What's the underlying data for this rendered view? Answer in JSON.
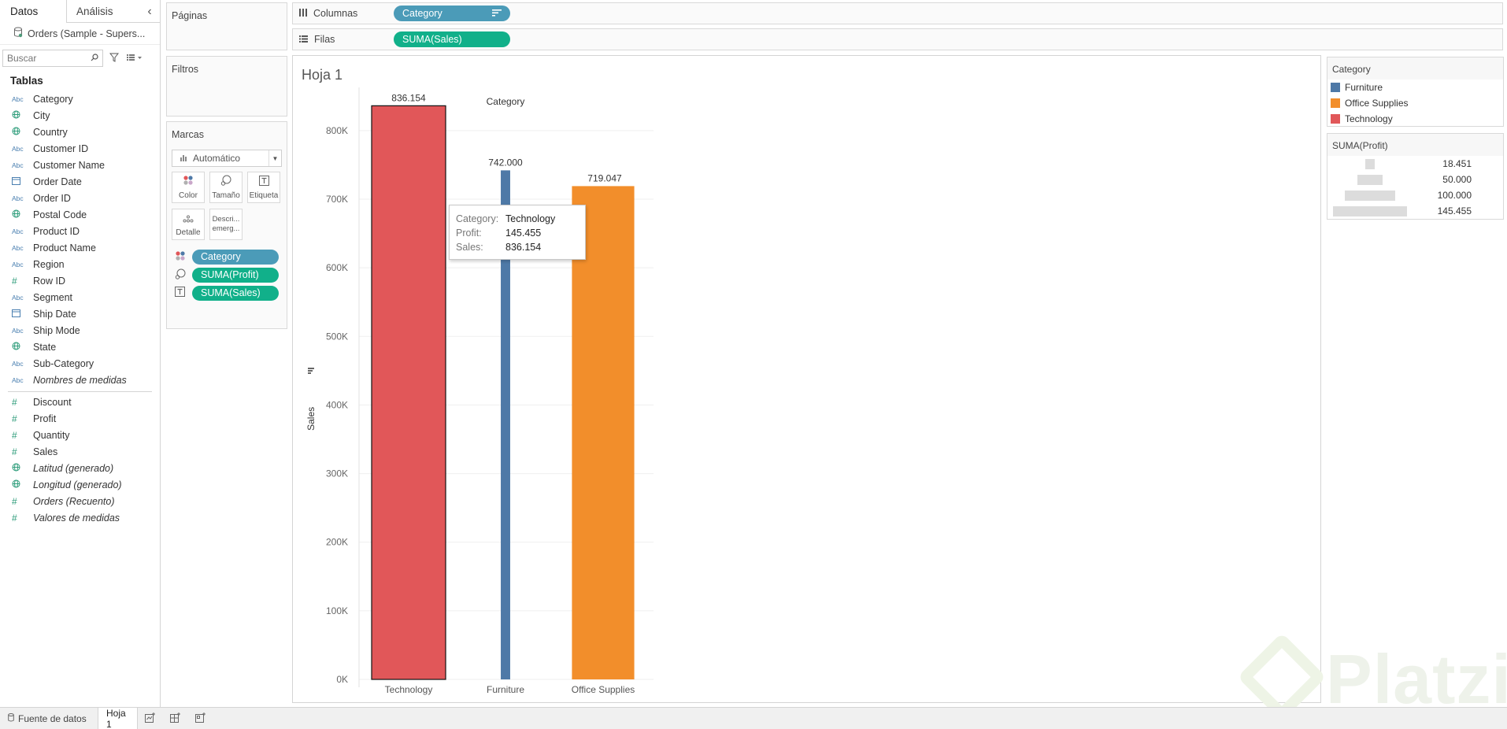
{
  "left_pane": {
    "tabs": [
      "Datos",
      "Análisis"
    ],
    "datasource": "Orders (Sample - Supers...",
    "search_placeholder": "Buscar",
    "tables_title": "Tablas",
    "dimensions": [
      {
        "type": "Abc",
        "name": "Category"
      },
      {
        "type": "geo",
        "name": "City"
      },
      {
        "type": "geo",
        "name": "Country"
      },
      {
        "type": "Abc",
        "name": "Customer ID"
      },
      {
        "type": "Abc",
        "name": "Customer Name"
      },
      {
        "type": "date",
        "name": "Order Date"
      },
      {
        "type": "Abc",
        "name": "Order ID"
      },
      {
        "type": "geo",
        "name": "Postal Code"
      },
      {
        "type": "Abc",
        "name": "Product ID"
      },
      {
        "type": "Abc",
        "name": "Product Name"
      },
      {
        "type": "Abc",
        "name": "Region"
      },
      {
        "type": "#",
        "name": "Row ID"
      },
      {
        "type": "Abc",
        "name": "Segment"
      },
      {
        "type": "date",
        "name": "Ship Date"
      },
      {
        "type": "Abc",
        "name": "Ship Mode"
      },
      {
        "type": "geo",
        "name": "State"
      },
      {
        "type": "Abc",
        "name": "Sub-Category"
      },
      {
        "type": "Abc",
        "name": "Nombres de medidas",
        "italic": true
      }
    ],
    "measures": [
      {
        "type": "#",
        "name": "Discount"
      },
      {
        "type": "#",
        "name": "Profit"
      },
      {
        "type": "#",
        "name": "Quantity"
      },
      {
        "type": "#",
        "name": "Sales"
      },
      {
        "type": "geo",
        "name": "Latitud (generado)",
        "italic": true
      },
      {
        "type": "geo",
        "name": "Longitud (generado)",
        "italic": true
      },
      {
        "type": "#",
        "name": "Orders (Recuento)",
        "italic": true
      },
      {
        "type": "#",
        "name": "Valores de medidas",
        "italic": true
      }
    ]
  },
  "cards": {
    "pages": "Páginas",
    "filters": "Filtros",
    "marks": "Marcas",
    "mark_type": "Automático",
    "mark_buttons": [
      "Color",
      "Tamaño",
      "Etiqueta",
      "Detalle",
      "Descri...\nemerg..."
    ],
    "mark_fields": [
      "Category",
      "SUMA(Profit)",
      "SUMA(Sales)"
    ]
  },
  "shelves": {
    "columns_label": "Columnas",
    "rows_label": "Filas",
    "columns_pill": "Category",
    "rows_pill": "SUMA(Sales)"
  },
  "sheet": {
    "title": "Hoja 1"
  },
  "chart_data": {
    "type": "bar",
    "title": "Category",
    "categories": [
      "Technology",
      "Furniture",
      "Office Supplies"
    ],
    "values": [
      836154,
      742000,
      719047
    ],
    "value_labels": [
      "836.154",
      "742.000",
      "719.047"
    ],
    "profit": [
      145455,
      18451,
      122491
    ],
    "colors": [
      "#e15759",
      "#4e79a7",
      "#f28e2b"
    ],
    "ylabel": "Sales",
    "ylim": [
      0,
      840000
    ],
    "yticks": [
      0,
      100000,
      200000,
      300000,
      400000,
      500000,
      600000,
      700000,
      800000
    ],
    "ytick_labels": [
      "0K",
      "100K",
      "200K",
      "300K",
      "400K",
      "500K",
      "600K",
      "700K",
      "800K"
    ]
  },
  "tooltip": {
    "rows": [
      {
        "key": "Category:",
        "val": "Technology"
      },
      {
        "key": "Profit:",
        "val": "145.455"
      },
      {
        "key": "Sales:",
        "val": "836.154"
      }
    ]
  },
  "legends": {
    "color_title": "Category",
    "color_items": [
      {
        "name": "Furniture",
        "color": "#4e79a7"
      },
      {
        "name": "Office Supplies",
        "color": "#f28e2b"
      },
      {
        "name": "Technology",
        "color": "#e15759"
      }
    ],
    "size_title": "SUMA(Profit)",
    "size_items": [
      {
        "label": "18.451",
        "value": 18451
      },
      {
        "label": "50.000",
        "value": 50000
      },
      {
        "label": "100.000",
        "value": 100000
      },
      {
        "label": "145.455",
        "value": 145455
      }
    ]
  },
  "bottom": {
    "datasource_tab": "Fuente de datos",
    "sheet_tab": "Hoja 1"
  },
  "watermark": "Platzi"
}
